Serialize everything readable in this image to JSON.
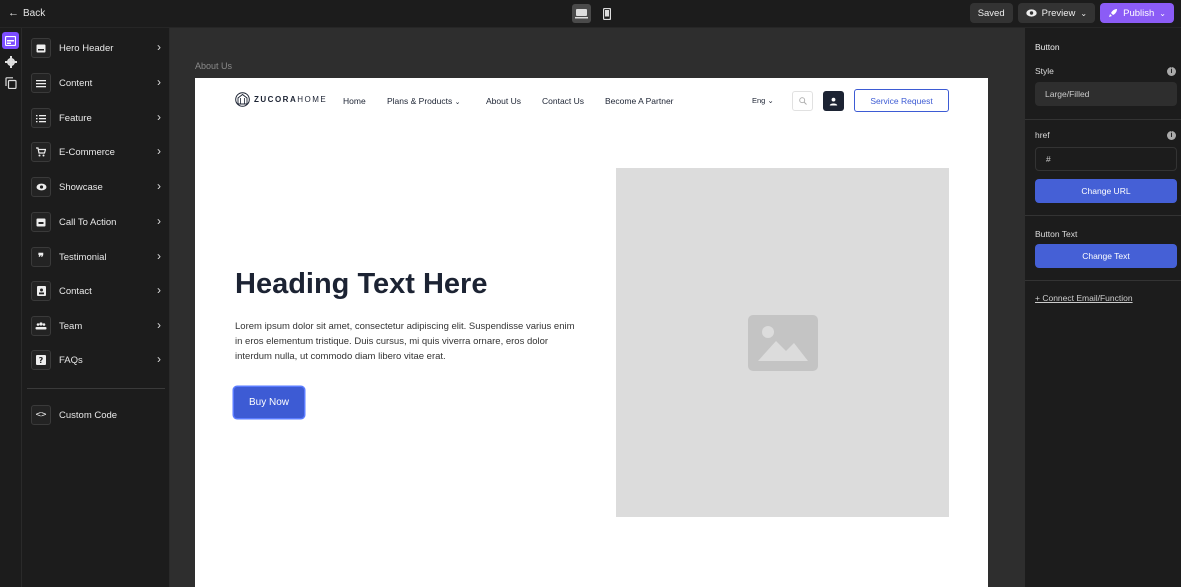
{
  "topbar": {
    "back_label": "Back",
    "saved_label": "Saved",
    "preview_label": "Preview",
    "publish_label": "Publish"
  },
  "sidebar": {
    "items": [
      {
        "label": "Hero Header",
        "icon": "hero-header-icon"
      },
      {
        "label": "Content",
        "icon": "content-icon"
      },
      {
        "label": "Feature",
        "icon": "feature-icon"
      },
      {
        "label": "E-Commerce",
        "icon": "cart-icon"
      },
      {
        "label": "Showcase",
        "icon": "eye-icon"
      },
      {
        "label": "Call To Action",
        "icon": "cta-icon"
      },
      {
        "label": "Testimonial",
        "icon": "quote-icon"
      },
      {
        "label": "Contact",
        "icon": "contact-icon"
      },
      {
        "label": "Team",
        "icon": "team-icon"
      },
      {
        "label": "FAQs",
        "icon": "faq-icon"
      }
    ],
    "custom_code_label": "Custom Code"
  },
  "canvas": {
    "breadcrumb": "About Us",
    "nav": {
      "logo_bold": "ZUCORA",
      "logo_light": "HOME",
      "links": [
        "Home",
        "Plans & Products",
        "About Us",
        "Contact Us",
        "Become A Partner"
      ],
      "lang": "Eng",
      "service_button": "Service Request"
    },
    "hero": {
      "heading": "Heading Text Here",
      "paragraph": "Lorem ipsum dolor sit amet, consectetur adipiscing elit. Suspendisse varius enim in eros elementum tristique. Duis cursus, mi quis viverra ornare, eros dolor interdum nulla, ut commodo diam libero vitae erat.",
      "button": "Buy Now"
    }
  },
  "inspector": {
    "title": "Button",
    "style_label": "Style",
    "style_value": "Large/Filled",
    "href_label": "href",
    "href_value": "#",
    "change_url": "Change URL",
    "button_text_label": "Button Text",
    "change_text": "Change Text",
    "connect_link": "+ Connect Email/Function"
  },
  "colors": {
    "accent": "#8b5cf6",
    "primary_blue": "#3d5bd4",
    "navy": "#1c2333"
  }
}
